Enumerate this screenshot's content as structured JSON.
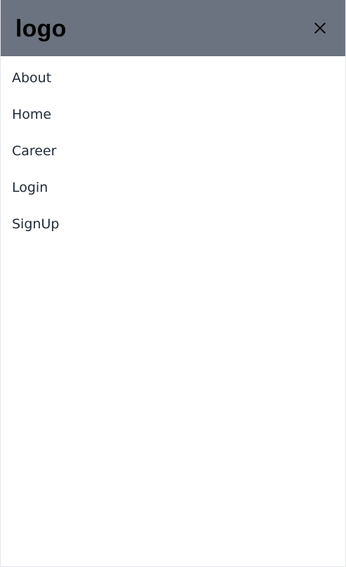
{
  "header": {
    "logo": "logo",
    "close_icon": "close-icon",
    "background": "#6b7280"
  },
  "nav": {
    "items": [
      {
        "label": "About"
      },
      {
        "label": "Home"
      },
      {
        "label": "Career"
      },
      {
        "label": "Login"
      },
      {
        "label": "SignUp"
      }
    ]
  }
}
